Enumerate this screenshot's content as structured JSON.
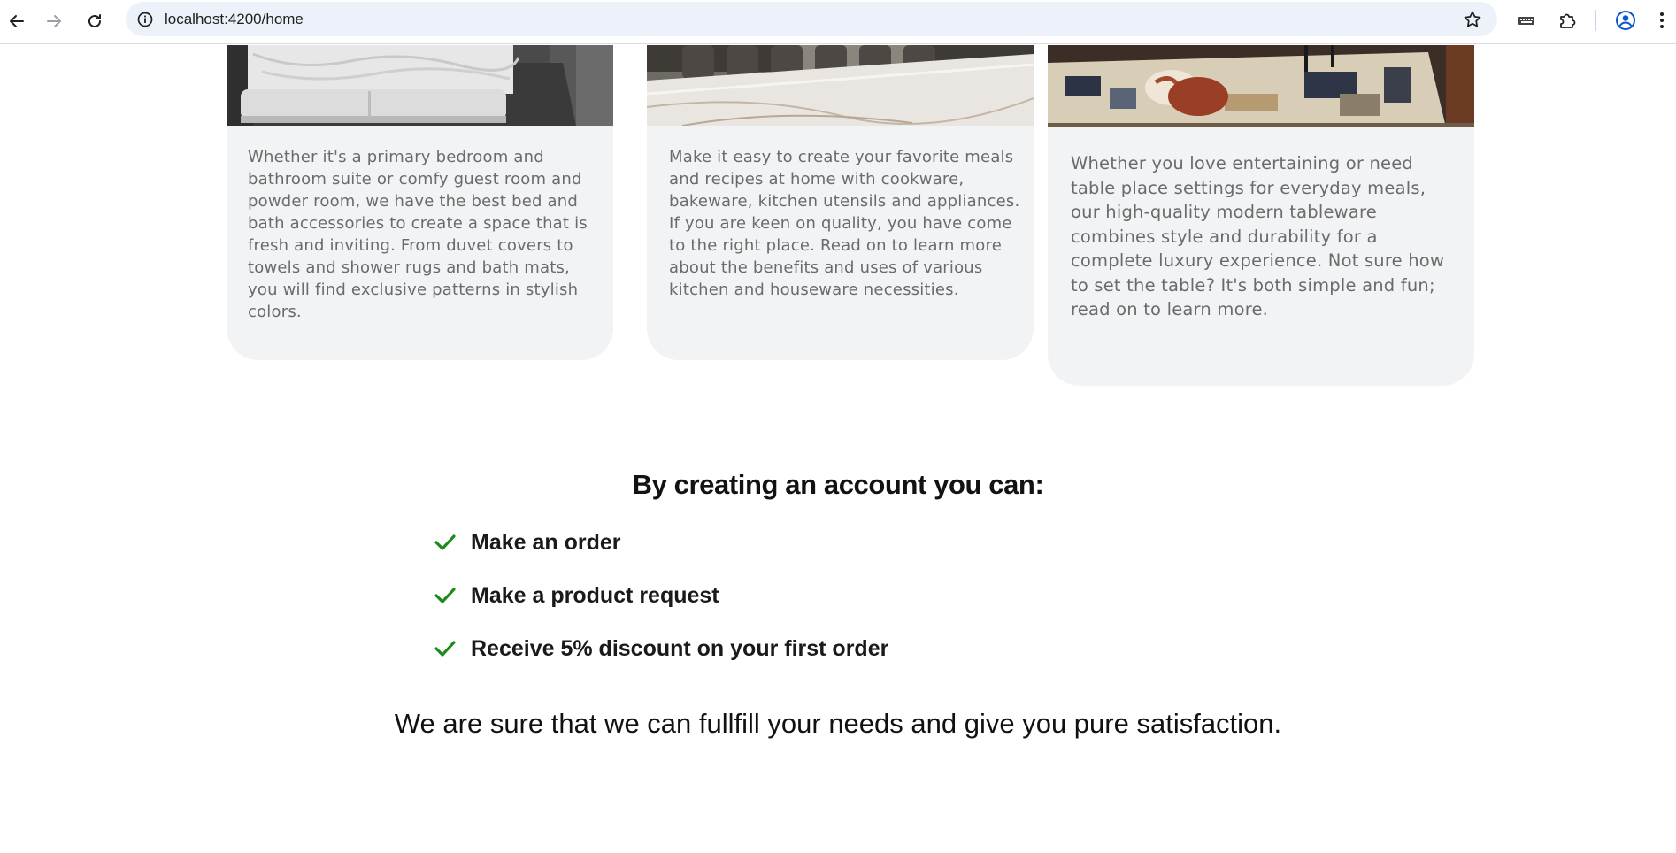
{
  "browser": {
    "url": "localhost:4200/home"
  },
  "cards": [
    {
      "text": "Whether it's a primary bedroom and bathroom suite or comfy guest room and powder room, we have the best bed and bath accessories to create a space that is fresh and inviting. From duvet covers to towels and shower rugs and bath mats, you will find exclusive patterns in stylish colors."
    },
    {
      "text": "Make it easy to create your favorite meals and recipes at home with cookware, bakeware, kitchen utensils and appliances. If you are keen on quality, you have come to the right place. Read on to learn more about the benefits and uses of various kitchen and houseware necessities."
    },
    {
      "text": "Whether you love entertaining or need table place settings for everyday meals, our high-quality modern tableware combines style and durability for a complete luxury experience. Not sure how to set the table? It's both simple and fun; read on to learn more."
    }
  ],
  "benefits": {
    "title": "By creating an account you can:",
    "items": [
      {
        "label": "Make an order"
      },
      {
        "label": "Make a product request"
      },
      {
        "label": "Receive 5% discount on your first order"
      }
    ]
  },
  "closing_text": "We are sure that we can fullfill your needs and give you pure satisfaction.",
  "colors": {
    "check": "#1e8a1e",
    "card_bg": "#f2f3f4",
    "omnibox_bg": "#edf2fa"
  }
}
